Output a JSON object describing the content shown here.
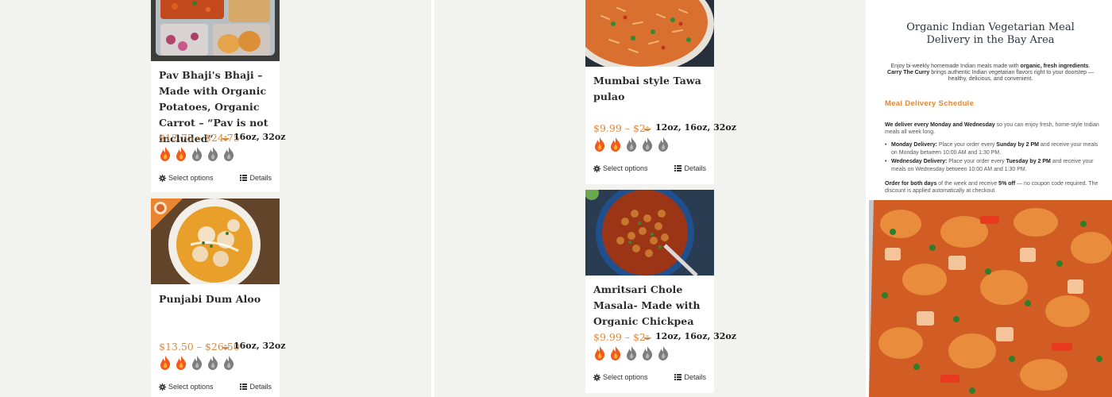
{
  "products": [
    {
      "title": "Pav Bhaji's Bhaji – Made with Organic Potatoes, Organic Carrot – “Pav is not included”",
      "price": "$12.75 – $24.75",
      "sizes": "16oz, 32oz",
      "spice_level": 2,
      "spice_max": 5,
      "image_icon": "pav-bhaji-photo",
      "select_label": "Select options",
      "details_label": "Details"
    },
    {
      "title": "Punjabi Dum Aloo",
      "price": "$13.50 – $26.50",
      "sizes": "16oz, 32oz",
      "spice_level": 2,
      "spice_max": 5,
      "image_icon": "dum-aloo-photo",
      "select_label": "Select options",
      "details_label": "Details"
    },
    {
      "title": "Mumbai style Tawa pulao",
      "price": "$9.99 – $2",
      "sizes": "12oz, 16oz, 32oz",
      "spice_level": 2,
      "spice_max": 5,
      "image_icon": "tawa-pulao-photo",
      "select_label": "Select options",
      "details_label": "Details"
    },
    {
      "title": "Amritsari Chole Masala- Made with Organic Chickpea",
      "price": "$9.99 – $2",
      "sizes": "12oz, 16oz, 32oz",
      "spice_level": 2,
      "spice_max": 5,
      "image_icon": "chole-masala-photo",
      "select_label": "Select options",
      "details_label": "Details"
    }
  ],
  "info": {
    "title": "Organic Indian Vegetarian Meal Delivery in the Bay Area",
    "intro_1": "Enjoy bi-weekly homemade Indian meals made with ",
    "intro_1_bold": "organic, fresh ingredients",
    "intro_1_end": ".",
    "intro_2_bold": "Carry The Curry",
    "intro_2": " brings authentic Indian vegetarian flavors right to your doorstep — healthy, delicious, and convenient.",
    "schedule_heading": "Meal Delivery Schedule",
    "p1_bold": "We deliver every Monday and Wednesday",
    "p1": " so you can enjoy fresh, home-style Indian meals all week long.",
    "monday_label": "Monday Delivery:",
    "monday_a": " Place your order every ",
    "monday_deadline": "Sunday by 2 PM",
    "monday_b": " and receive your meals on Monday between 10:00 AM and 1:30 PM.",
    "wednesday_label": "Wednesday Delivery:",
    "wednesday_a": " Place your order every ",
    "wednesday_deadline": "Tuesday by 2 PM",
    "wednesday_b": " and receive your meals on Wednesday between 10:00 AM and 1:30 PM.",
    "p2_bold": "Order for both days",
    "p2_a": " of the week and receive ",
    "p2_discount": "5% off",
    "p2_b": " — no coupon code required. The discount is applied automatically at checkout."
  },
  "colors": {
    "price": "#e2883a",
    "heading_accent": "#e2883a",
    "flame_active": "#f05a1e",
    "flame_inactive": "#7d7d7d",
    "column_bg": "#f2f2ee"
  },
  "hero_image_icon": "vegetable-curry-photo"
}
